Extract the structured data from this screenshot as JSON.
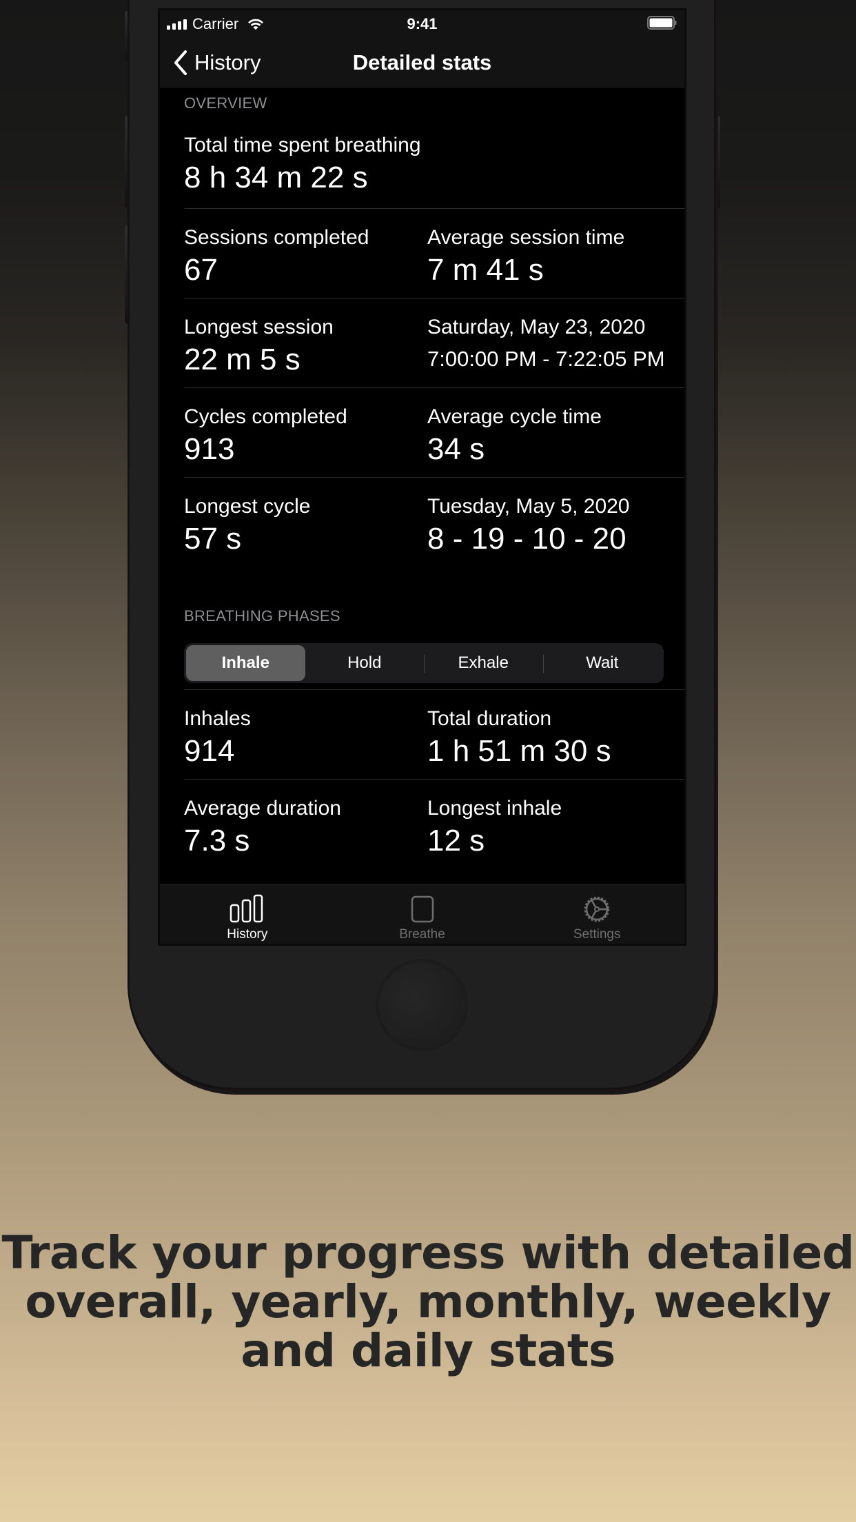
{
  "status_bar": {
    "carrier": "Carrier",
    "time": "9:41",
    "icons": [
      "signal-icon",
      "wifi-icon",
      "battery-icon"
    ]
  },
  "nav": {
    "back_label": "History",
    "title": "Detailed stats"
  },
  "overview": {
    "header": "OVERVIEW",
    "total_time": {
      "label": "Total time spent breathing",
      "value": "8 h 34 m 22 s"
    },
    "rows": [
      [
        {
          "label": "Sessions completed",
          "value": "67"
        },
        {
          "label": "Average session time",
          "value": "7 m 41 s"
        }
      ],
      [
        {
          "label": "Longest session",
          "value": "22 m 5 s"
        },
        {
          "label": "Saturday, May 23, 2020",
          "value": "7:00:00 PM - 7:22:05 PM"
        }
      ],
      [
        {
          "label": "Cycles completed",
          "value": "913"
        },
        {
          "label": "Average cycle time",
          "value": "34 s"
        }
      ],
      [
        {
          "label": "Longest cycle",
          "value": "57 s"
        },
        {
          "label": "Tuesday, May 5, 2020",
          "value": "8 - 19 - 10 - 20"
        }
      ]
    ]
  },
  "phases": {
    "header": "BREATHING PHASES",
    "segments": [
      "Inhale",
      "Hold",
      "Exhale",
      "Wait"
    ],
    "selected": "Inhale",
    "rows": [
      [
        {
          "label": "Inhales",
          "value": "914"
        },
        {
          "label": "Total duration",
          "value": "1 h 51 m 30 s"
        }
      ],
      [
        {
          "label": "Average duration",
          "value": "7.3 s"
        },
        {
          "label": "Longest inhale",
          "value": "12 s"
        }
      ]
    ]
  },
  "tabbar": {
    "tabs": [
      {
        "label": "History",
        "icon": "bar-chart-icon",
        "active": true
      },
      {
        "label": "Breathe",
        "icon": "square-icon",
        "active": false
      },
      {
        "label": "Settings",
        "icon": "gear-icon",
        "active": false
      }
    ]
  },
  "marketing": {
    "headline_lines": [
      "Track your progress with detailed",
      "overall, yearly, monthly, weekly",
      "and daily stats"
    ]
  },
  "colors": {
    "screen_bg": "#000000",
    "bar_bg": "#131313",
    "secondary_text": "#8e8e93",
    "segment_active": "#5f5f5f",
    "headline": "#262626",
    "bg_top": "#171717",
    "bg_bottom": "#e3cda2"
  }
}
